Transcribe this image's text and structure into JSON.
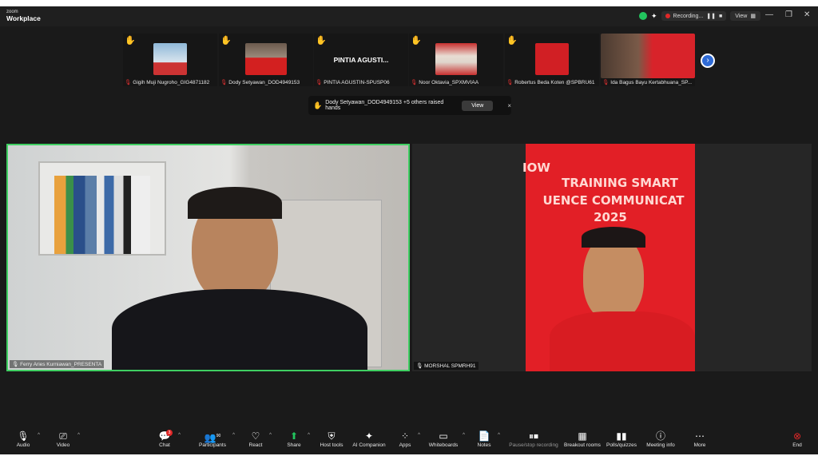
{
  "app": {
    "brand_small": "zoom",
    "brand_big": "Workplace"
  },
  "titlebar": {
    "recording_label": "Recording...",
    "view_label": "View",
    "minimize": "—",
    "restore": "❐",
    "close": "✕"
  },
  "participants": [
    {
      "name": "Gigih Muji Nugroho_GIG4871182",
      "hand": "✋"
    },
    {
      "name": "Dody Setyawan_DOD4949153",
      "hand": "✋"
    },
    {
      "name": "PINTIA AGUSTIN-SPUSP06",
      "display": "PINTIA AGUSTI...",
      "hand": "✋"
    },
    {
      "name": "Noor Oktavia_SPXMVIAA",
      "hand": "✋"
    },
    {
      "name": "Robertus Beda Koten @SPBRU61",
      "hand": "✋"
    },
    {
      "name": "Ida Bagus Bayu Kertabhuana_SP...",
      "hand": "✋"
    }
  ],
  "strip_next_icon": "chevron-right-icon",
  "raised_hands": {
    "text": "Dody Setyawan_DOD4949153 +5 others raised hands",
    "view_button": "View",
    "close": "×"
  },
  "main_videos": {
    "left_name": "Ferry Aries Kurniawan_PRESENTA",
    "right_name": "MORSHAL SPMRH91",
    "slide_lines": [
      "IOW",
      "TRAINING SMART",
      "UENCE COMMUNICAT",
      "2025"
    ]
  },
  "toolbar": {
    "audio": "Audio",
    "video": "Video",
    "chat": "Chat",
    "chat_badge": "3",
    "participants": "Participants",
    "participants_count": "90",
    "react": "React",
    "share": "Share",
    "host_tools": "Host tools",
    "ai_companion": "AI Companion",
    "apps": "Apps",
    "whiteboards": "Whiteboards",
    "notes": "Notes",
    "pause_stop_recording": "Pause/stop recording",
    "breakout_rooms": "Breakout rooms",
    "polls": "Polls/quizzes",
    "meeting_info": "Meeting info",
    "more": "More",
    "end": "End"
  },
  "colors": {
    "active_speaker_border": "#3fcf62",
    "slide_red": "#e21f26",
    "end_red": "#e02828",
    "next_blue": "#2f6bd6"
  }
}
